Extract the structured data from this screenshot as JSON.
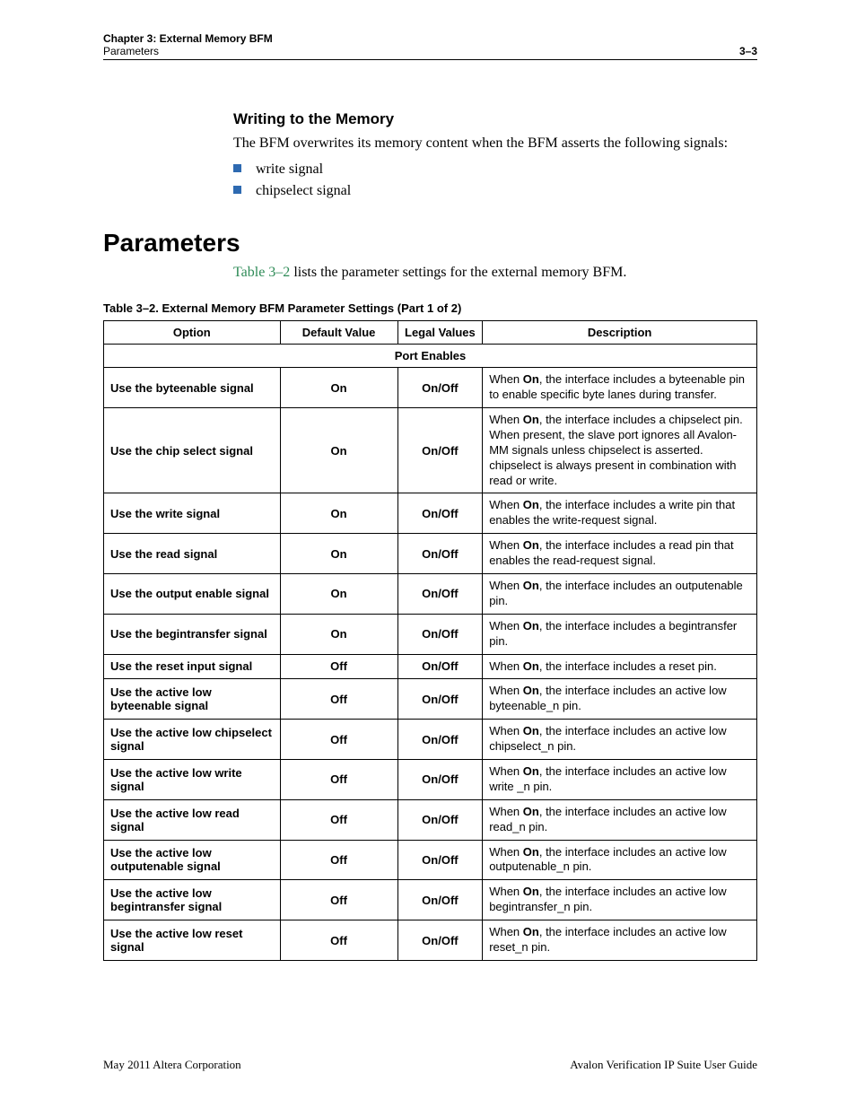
{
  "header": {
    "chapter": "Chapter 3:  External Memory BFM",
    "sub": "Parameters",
    "pagenum": "3–3"
  },
  "section": {
    "title": "Writing to the Memory",
    "body": "The BFM overwrites its memory content when the BFM asserts the following signals:",
    "bullets": [
      "write signal",
      "chipselect signal"
    ]
  },
  "params_heading": "Parameters",
  "params_intro_pre": "Table 3–2",
  "params_intro_post": " lists the parameter settings for the external memory BFM.",
  "table": {
    "caption": "Table 3–2.  External Memory BFM Parameter Settings  (Part 1 of 2)",
    "head": {
      "option": "Option",
      "default": "Default Value",
      "legal": "Legal Values",
      "desc": "Description"
    },
    "group": "Port Enables",
    "rows": [
      {
        "option": "Use the byteenable signal",
        "default": "On",
        "legal": "On/Off",
        "desc": "When <b>On</b>, the interface includes a byteenable pin to enable specific byte lanes during transfer."
      },
      {
        "option": "Use the chip select signal",
        "default": "On",
        "legal": "On/Off",
        "desc": "When <b>On</b>, the interface includes a chipselect pin. When present, the slave port ignores all Avalon-MM signals unless chipselect is asserted. chipselect is always present in combination with read or write."
      },
      {
        "option": "Use the write signal",
        "default": "On",
        "legal": "On/Off",
        "desc": "When <b>On</b>, the interface includes a write pin that enables the write-request signal."
      },
      {
        "option": "Use the read signal",
        "default": "On",
        "legal": "On/Off",
        "desc": "When <b>On</b>, the interface includes a read pin that enables the read-request signal."
      },
      {
        "option": "Use the output enable signal",
        "default": "On",
        "legal": "On/Off",
        "desc": "When <b>On</b>, the interface includes an outputenable pin."
      },
      {
        "option": "Use the begintransfer signal",
        "default": "On",
        "legal": "On/Off",
        "desc": "When <b>On</b>, the interface includes a begintransfer pin."
      },
      {
        "option": "Use the reset input signal",
        "default": "Off",
        "legal": "On/Off",
        "desc": "When <b>On</b>, the interface includes a reset pin."
      },
      {
        "option": "Use the active low byteenable signal",
        "default": "Off",
        "legal": "On/Off",
        "desc": "When <b>On</b>, the interface includes an active low byteenable_n pin."
      },
      {
        "option": "Use the active low chipselect signal",
        "default": "Off",
        "legal": "On/Off",
        "desc": "When <b>On</b>, the interface includes an active low chipselect_n pin."
      },
      {
        "option": "Use the active low write signal",
        "default": "Off",
        "legal": "On/Off",
        "desc": "When <b>On</b>, the interface includes an active low write _n pin."
      },
      {
        "option": "Use the active low read signal",
        "default": "Off",
        "legal": "On/Off",
        "desc": "When <b>On</b>, the interface includes an active low read_n pin."
      },
      {
        "option": "Use the active low outputenable signal",
        "default": "Off",
        "legal": "On/Off",
        "desc": "When <b>On</b>, the interface includes an active low outputenable_n pin."
      },
      {
        "option": "Use the active low begintransfer signal",
        "default": "Off",
        "legal": "On/Off",
        "desc": "When <b>On</b>, the interface includes an active low begintransfer_n pin."
      },
      {
        "option": "Use the active low reset signal",
        "default": "Off",
        "legal": "On/Off",
        "desc": "When <b>On</b>, the interface includes an active low reset_n pin."
      }
    ]
  },
  "footer": {
    "left": "May 2011   Altera Corporation",
    "right": "Avalon Verification IP Suite User Guide"
  }
}
